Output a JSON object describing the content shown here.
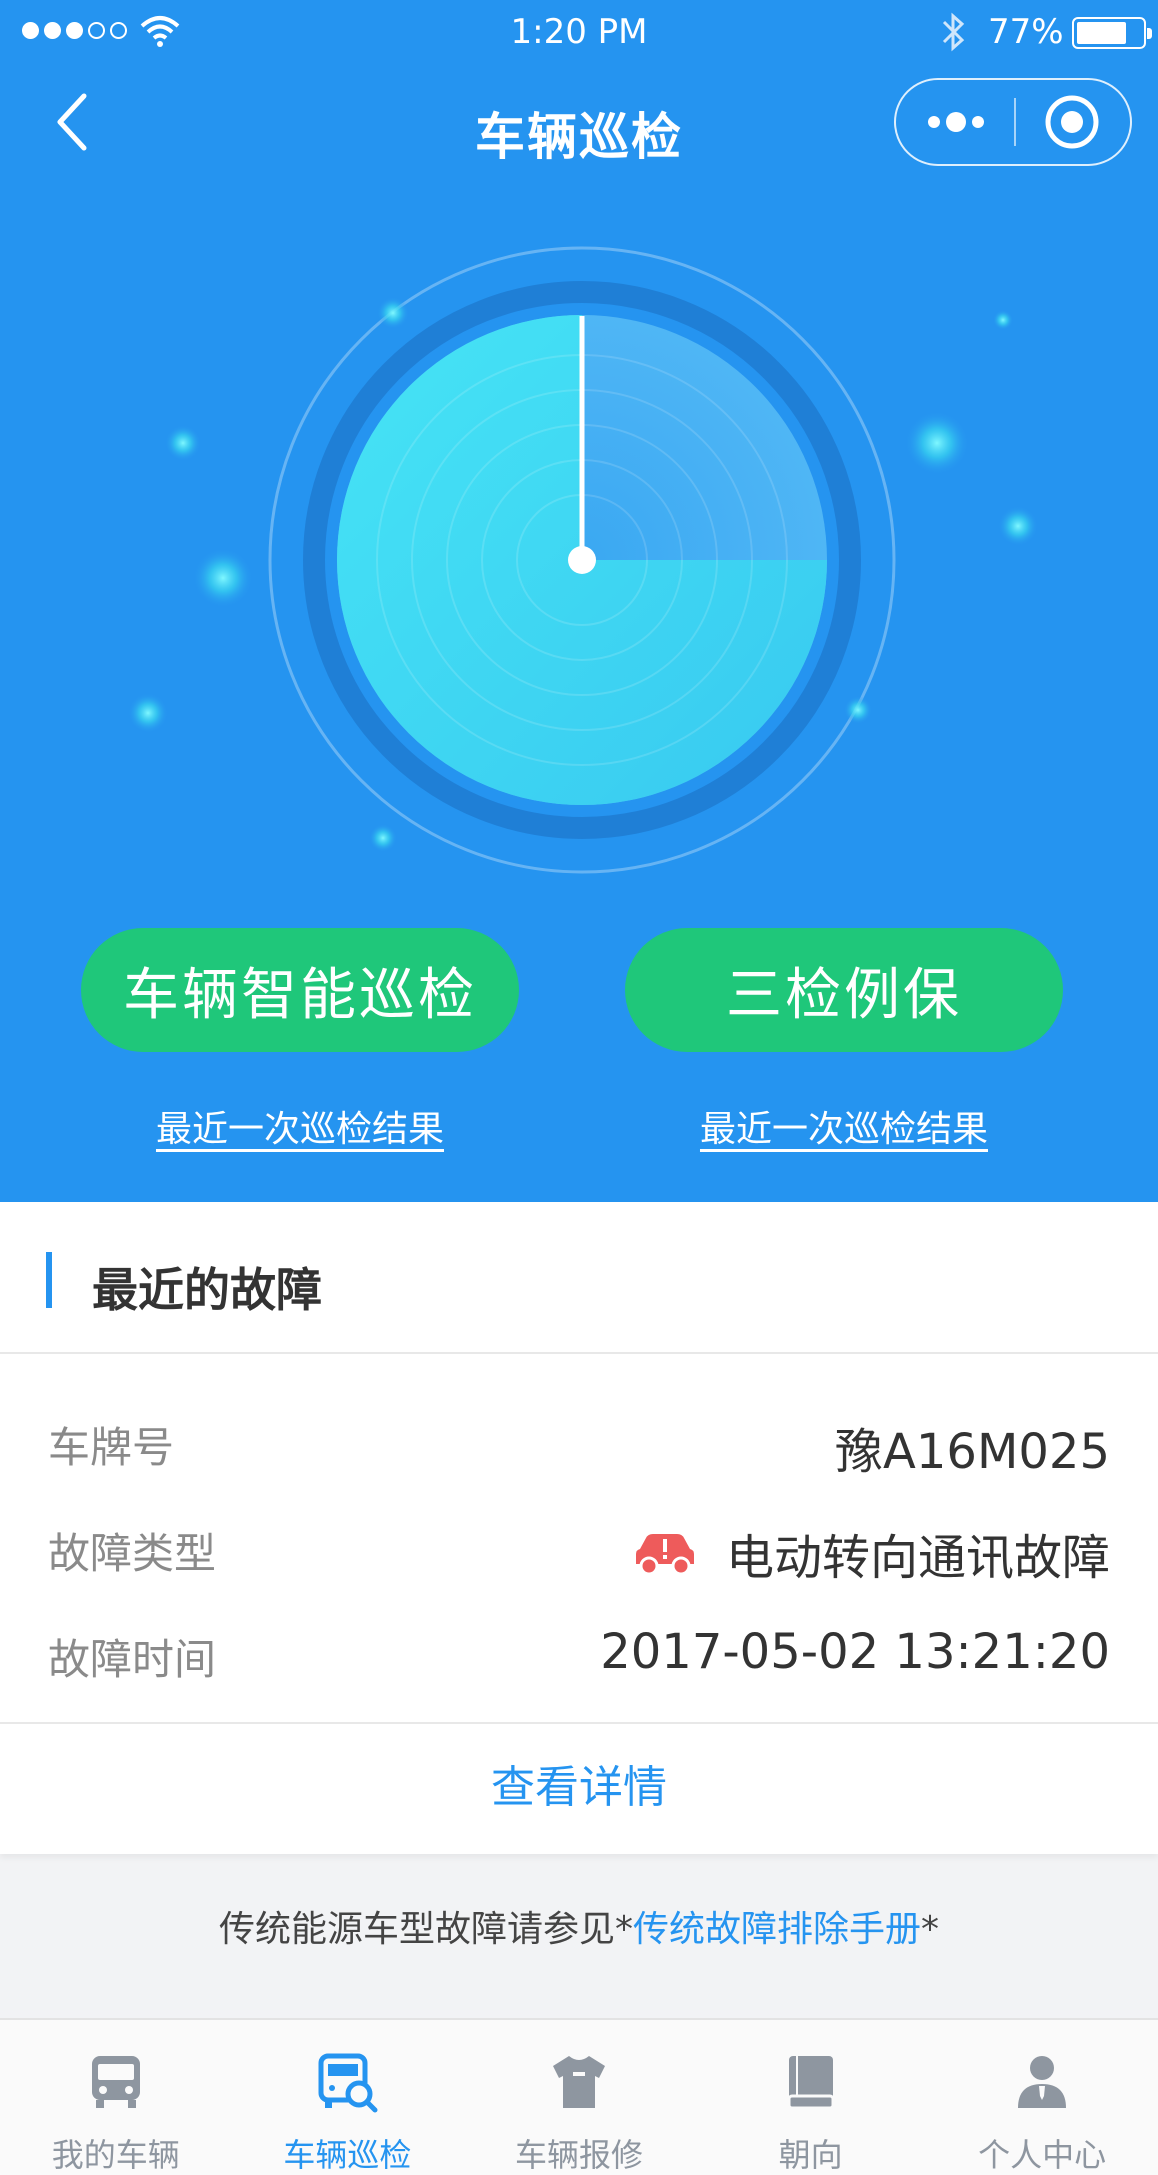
{
  "status_bar": {
    "time": "1:20 PM",
    "battery": "77%",
    "battery_level": 0.77,
    "icons": [
      "signal-dots",
      "wifi-icon",
      "bluetooth-icon",
      "battery-icon"
    ]
  },
  "nav": {
    "title": "车辆巡检",
    "icons": [
      "back-chevron-icon",
      "more-dots-icon",
      "close-target-icon"
    ]
  },
  "actions": {
    "smart_inspection": "车辆智能巡检",
    "three_checks": "三检例保",
    "last_result_left": "最近一次巡检结果",
    "last_result_right": "最近一次巡检结果"
  },
  "fault_card": {
    "title": "最近的故障",
    "plate_label": "车牌号",
    "plate_value": "豫A16M025",
    "type_label": "故障类型",
    "type_value": "电动转向通讯故障",
    "type_icon": "car-alert-icon",
    "time_label": "故障时间",
    "time_value": "2017-05-02 13:21:20",
    "detail_link": "查看详情"
  },
  "footer": {
    "note_prefix": "传统能源车型故障请参见*",
    "manual_link": "传统故障排除手册",
    "note_suffix": "*"
  },
  "tabbar": {
    "items": [
      {
        "label": "我的车辆",
        "icon": "bus-icon"
      },
      {
        "label": "车辆巡检",
        "icon": "bus-search-icon"
      },
      {
        "label": "车辆报修",
        "icon": "repair-shirt-icon"
      },
      {
        "label": "朝向",
        "icon": "book-icon"
      },
      {
        "label": "个人中心",
        "icon": "person-icon"
      }
    ],
    "active_index": 1
  },
  "colors": {
    "primary_blue": "#2594f0",
    "button_green": "#1fc77a",
    "alert_red": "#ee5b5b"
  }
}
